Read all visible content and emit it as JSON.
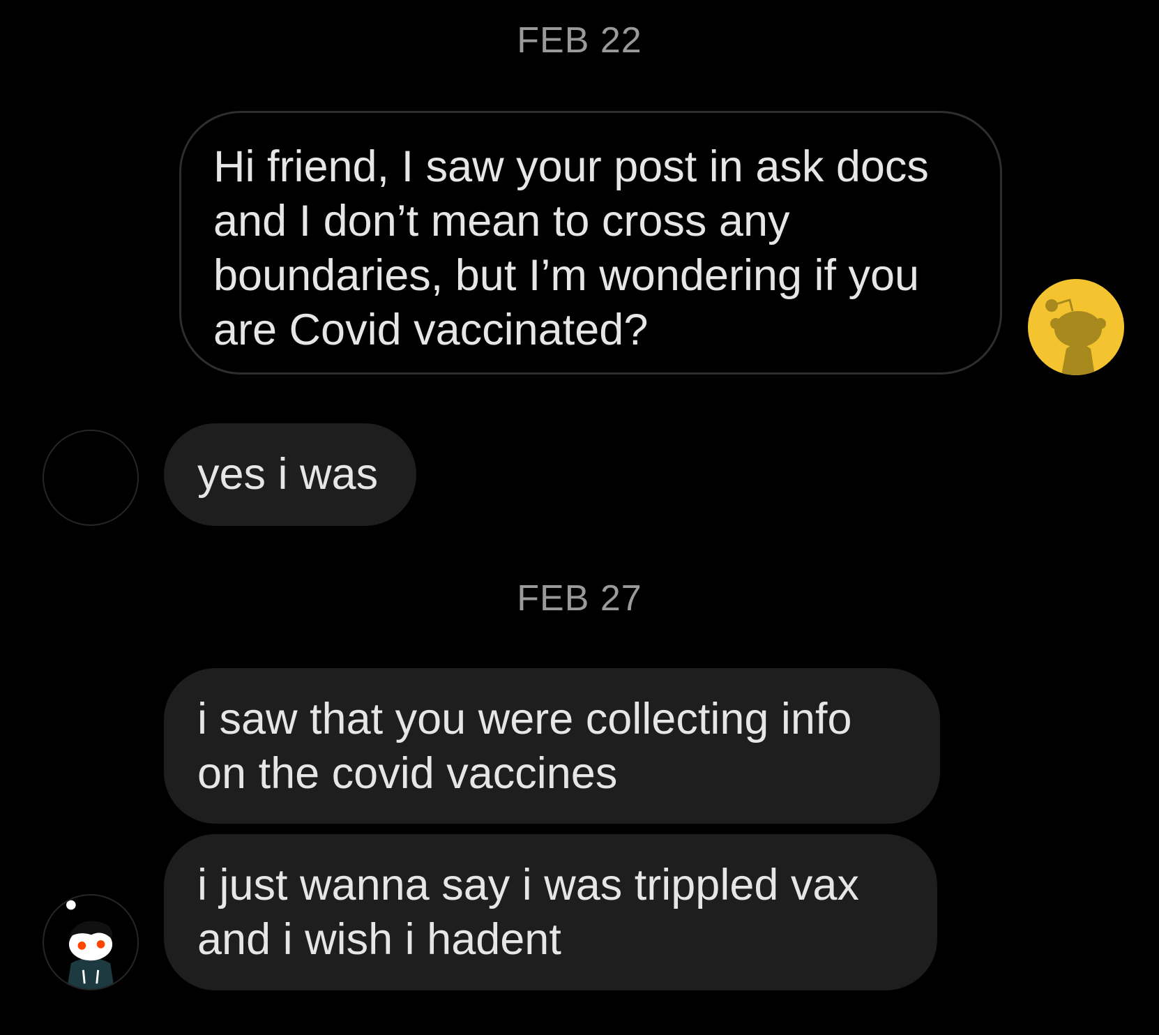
{
  "conversation": {
    "dates": [
      "FEB 22",
      "FEB 27"
    ],
    "messages": [
      {
        "sender": "self",
        "text": "Hi friend, I saw your post in ask docs and I don’t mean to cross any boundaries, but I’m wondering if you are Covid vaccinated?"
      },
      {
        "sender": "other",
        "text": "yes i was"
      },
      {
        "sender": "other",
        "text": "i saw that you were collecting info on the covid vaccines"
      },
      {
        "sender": "other",
        "text": "i just wanna say i was trippled vax and i wish i hadent"
      }
    ]
  },
  "colors": {
    "background": "#000000",
    "incoming_bubble": "#1e1e1e",
    "outgoing_bubble_border": "#2e2e2e",
    "date_text": "#9a9a9a",
    "message_text": "#e6e6e6",
    "self_avatar": "#f4c430"
  },
  "icons": {
    "self_avatar": "reddit-snoo-yellow-icon",
    "other_avatar": "reddit-snoo-character-icon"
  }
}
